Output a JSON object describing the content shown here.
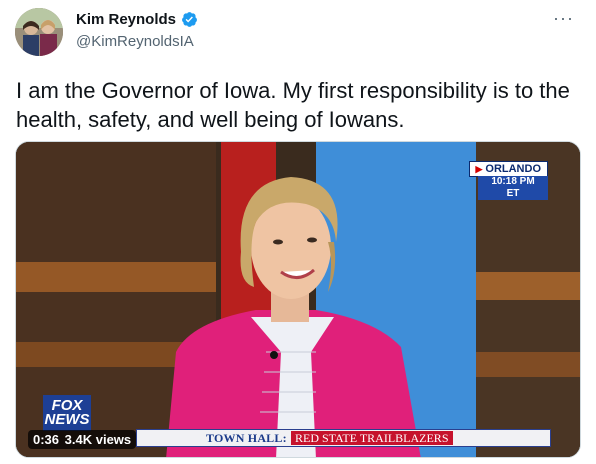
{
  "author": {
    "name": "Kim Reynolds",
    "handle": "@KimReynoldsIA",
    "verified_icon": "verified-badge-icon",
    "more_label": "···"
  },
  "tweet": {
    "text": "I am the Governor of Iowa. My first responsibility is to the health, safety, and well being of Iowans."
  },
  "video": {
    "location": "ORLANDO",
    "time": "10:18 PM ET",
    "network": "FOX NEWS",
    "ticker_title": "TOWN HALL:",
    "ticker_subtitle": "RED STATE TRAILBLAZERS",
    "duration": "0:36",
    "views": "3.4K views"
  },
  "colors": {
    "brand_blue": "#1d9bf0",
    "ticker_red": "#c6122c",
    "ticker_blue": "#1b3a8a",
    "jacket_pink": "#e0207a"
  }
}
